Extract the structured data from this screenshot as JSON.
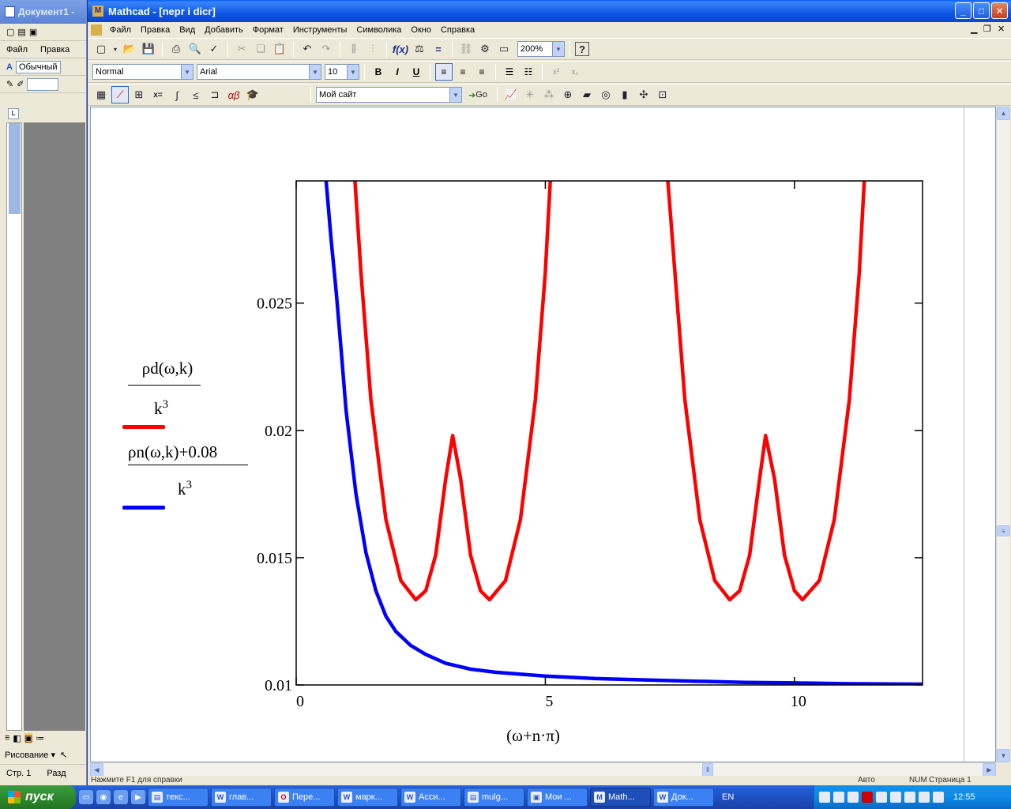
{
  "word": {
    "title": "Документ1 -",
    "menu": [
      "Файл",
      "Правка"
    ],
    "style_value": "Обычный",
    "status_page": "Стр. 1",
    "status_section": "Разд",
    "drawing_label": "Рисование ▾"
  },
  "window": {
    "title": "Mathcad - [nepr i dicr]",
    "app_name": "Mathcad"
  },
  "menubar": [
    "Файл",
    "Правка",
    "Вид",
    "Добавить",
    "Формат",
    "Инструменты",
    "Символика",
    "Окно",
    "Справка"
  ],
  "toolbar": {
    "zoom": "200%"
  },
  "format_toolbar": {
    "style": "Normal",
    "font": "Arial",
    "size": "10",
    "bold": "B",
    "italic": "I",
    "underline": "U"
  },
  "resource_toolbar": {
    "site": "Мой сайт",
    "go": "Go"
  },
  "plot": {
    "legend": {
      "top_numerator": "ρd(ω,k)",
      "top_denominator": "k",
      "top_exponent": "3",
      "bottom_numerator": "ρn(ω,k)+0.08",
      "bottom_denominator": "k",
      "bottom_exponent": "3"
    },
    "xlabel": "(ω+n·π)",
    "colors": {
      "red": "#ff0000",
      "blue": "#0000ff"
    }
  },
  "chart_data": {
    "type": "line",
    "xlabel": "(ω+n·π)",
    "xlim": [
      0,
      12.57
    ],
    "ylim": [
      0.01,
      0.0298
    ],
    "x_ticks": [
      "0",
      "5",
      "10"
    ],
    "y_ticks": [
      "0.01",
      "0.015",
      "0.02",
      "0.025"
    ],
    "series": [
      {
        "name": "ρd(ω,k)/k³",
        "color": "#ff0000",
        "segments": [
          [
            [
              1.18,
              0.0298
            ],
            [
              1.3,
              0.0262
            ],
            [
              1.5,
              0.0212
            ],
            [
              1.8,
              0.0165
            ],
            [
              2.1,
              0.0141
            ],
            [
              2.4,
              0.01335
            ],
            [
              2.6,
              0.0137
            ],
            [
              2.8,
              0.0151
            ],
            [
              3.0,
              0.0181
            ],
            [
              3.14,
              0.0198
            ],
            [
              3.3,
              0.0181
            ],
            [
              3.5,
              0.0151
            ],
            [
              3.7,
              0.0137
            ],
            [
              3.88,
              0.01335
            ],
            [
              4.2,
              0.0141
            ],
            [
              4.5,
              0.0165
            ],
            [
              4.8,
              0.0212
            ],
            [
              5.0,
              0.0262
            ],
            [
              5.1,
              0.0298
            ]
          ],
          [
            [
              7.46,
              0.0298
            ],
            [
              7.6,
              0.0262
            ],
            [
              7.8,
              0.0212
            ],
            [
              8.1,
              0.0165
            ],
            [
              8.4,
              0.0141
            ],
            [
              8.7,
              0.01335
            ],
            [
              8.9,
              0.0137
            ],
            [
              9.1,
              0.0151
            ],
            [
              9.3,
              0.0181
            ],
            [
              9.42,
              0.0198
            ],
            [
              9.6,
              0.0181
            ],
            [
              9.8,
              0.0151
            ],
            [
              10.0,
              0.0137
            ],
            [
              10.16,
              0.01335
            ],
            [
              10.5,
              0.0141
            ],
            [
              10.8,
              0.0165
            ],
            [
              11.1,
              0.0212
            ],
            [
              11.3,
              0.0262
            ],
            [
              11.4,
              0.0298
            ]
          ]
        ]
      },
      {
        "name": "ρn(ω,k)+0.08 / k³",
        "color": "#0000ff",
        "segments": [
          [
            [
              0.6,
              0.0298
            ],
            [
              0.7,
              0.0275
            ],
            [
              0.8,
              0.0255
            ],
            [
              0.9,
              0.0232
            ],
            [
              1.0,
              0.0208
            ],
            [
              1.2,
              0.0175
            ],
            [
              1.4,
              0.0152
            ],
            [
              1.6,
              0.0137
            ],
            [
              1.8,
              0.0127
            ],
            [
              2.0,
              0.0121
            ],
            [
              2.3,
              0.01155
            ],
            [
              2.6,
              0.0112
            ],
            [
              3.0,
              0.01085
            ],
            [
              3.5,
              0.01062
            ],
            [
              4.0,
              0.0105
            ],
            [
              5.0,
              0.01035
            ],
            [
              6.0,
              0.01025
            ],
            [
              7.0,
              0.0102
            ],
            [
              8.0,
              0.01015
            ],
            [
              9.0,
              0.0101
            ],
            [
              10.0,
              0.01008
            ],
            [
              11.0,
              0.01005
            ],
            [
              12.57,
              0.01003
            ]
          ]
        ]
      }
    ]
  },
  "statusbar": {
    "hint": "Нажмите F1 для справки",
    "mode": "Авто",
    "num": "NUM",
    "page": "Страница 1"
  },
  "taskbar": {
    "start": "пуск",
    "tasks": [
      "текс...",
      "глав...",
      "Пере...",
      "марк...",
      "Асси...",
      "mulg...",
      "Мои ...",
      "Math...",
      "Док..."
    ],
    "lang": "EN",
    "clock": "12:55"
  }
}
